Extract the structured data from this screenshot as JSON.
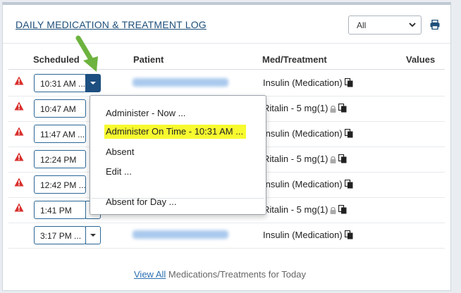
{
  "panel": {
    "title": "DAILY MEDICATION & TREATMENT LOG",
    "filter_value": "All",
    "print_icon": "printer-icon"
  },
  "columns": [
    "Scheduled",
    "Patient",
    "Med/Treatment",
    "Values"
  ],
  "rows": [
    {
      "warning": true,
      "time": "10:31 AM ...",
      "med": "Insulin (Medication)",
      "locked": false
    },
    {
      "warning": true,
      "time": "10:47 AM",
      "med": "Ritalin - 5 mg(1)",
      "locked": true
    },
    {
      "warning": true,
      "time": "11:47 AM ...",
      "med": "Insulin (Medication)",
      "locked": false
    },
    {
      "warning": true,
      "time": "12:24 PM",
      "med": "Ritalin - 5 mg(1)",
      "locked": true
    },
    {
      "warning": true,
      "time": "12:42 PM ...",
      "med": "Insulin (Medication)",
      "locked": false
    },
    {
      "warning": true,
      "time": "1:41 PM",
      "med": "Ritalin - 5 mg(1)",
      "locked": true
    },
    {
      "warning": false,
      "time": "3:17 PM ...",
      "med": "Insulin (Medication)",
      "locked": false
    }
  ],
  "dropdown_menu": {
    "items": [
      "Administer - Now ...",
      "Administer On Time - 10:31 AM ...",
      "Absent",
      "Edit ...",
      "Absent for Day ..."
    ],
    "highlighted_index": 1
  },
  "footer": {
    "link": "View All",
    "text": " Medications/Treatments for Today"
  },
  "colors": {
    "accent": "#1d4f80",
    "warning": "#d9302c",
    "highlight": "#f7fa2f",
    "arrow": "#6db33f"
  }
}
